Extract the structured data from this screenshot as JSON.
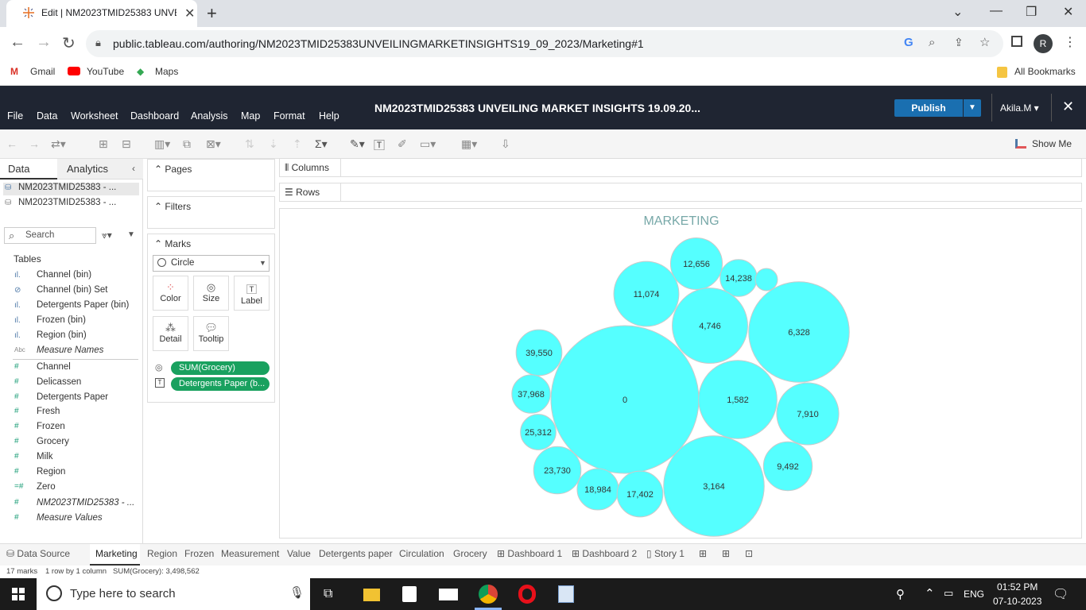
{
  "browser": {
    "tab_title": "Edit | NM2023TMID25383 UNVE",
    "url": "public.tableau.com/authoring/NM2023TMID25383UNVEILINGMARKETINSIGHTS19_09_2023/Marketing#1",
    "profile_initial": "R",
    "bookmarks": [
      "Gmail",
      "YouTube",
      "Maps"
    ],
    "all_bookmarks": "All Bookmarks"
  },
  "tableau": {
    "menus": [
      "File",
      "Data",
      "Worksheet",
      "Dashboard",
      "Analysis",
      "Map",
      "Format",
      "Help"
    ],
    "workbook_title": "NM2023TMID25383 UNVEILING MARKET INSIGHTS 19.09.20...",
    "publish_label": "Publish",
    "user": "Akila.M ▾",
    "show_me": "Show Me"
  },
  "data_pane": {
    "tab_data": "Data",
    "tab_analytics": "Analytics",
    "datasources": [
      "NM2023TMID25383 - ...",
      "NM2023TMID25383 - ..."
    ],
    "search_placeholder": "Search",
    "tables_label": "Tables",
    "dimensions": [
      "Channel (bin)",
      "Channel (bin) Set",
      "Detergents Paper (bin)",
      "Frozen (bin)",
      "Region (bin)",
      "Measure Names"
    ],
    "measures": [
      "Channel",
      "Delicassen",
      "Detergents Paper",
      "Fresh",
      "Frozen",
      "Grocery",
      "Milk",
      "Region",
      "Zero",
      "NM2023TMID25383 - ...",
      "Measure Values"
    ]
  },
  "cards": {
    "pages": "Pages",
    "filters": "Filters",
    "marks": "Marks",
    "mark_type": "Circle",
    "buttons": [
      "Color",
      "Size",
      "Label",
      "Detail",
      "Tooltip"
    ],
    "pills": [
      "SUM(Grocery)",
      "Detergents Paper (b..."
    ]
  },
  "shelves": {
    "columns": "Columns",
    "rows": "Rows"
  },
  "chart_data": {
    "type": "packed-bubble",
    "title": "MARKETING",
    "size_measure": "SUM(Grocery)",
    "label_field": "Detergents Paper (bin)",
    "color": "#55ffff",
    "labels": [
      "0",
      "12,656",
      "14,238",
      "11,074",
      "4,746",
      "6,328",
      "39,550",
      "37,968",
      "1,582",
      "7,910",
      "25,312",
      "23,730",
      "18,984",
      "17,402",
      "3,164",
      "9,492",
      ""
    ],
    "relative_size": [
      1.0,
      0.35,
      0.25,
      0.44,
      0.51,
      0.68,
      0.31,
      0.26,
      0.53,
      0.42,
      0.24,
      0.32,
      0.28,
      0.31,
      0.68,
      0.33,
      0.15
    ]
  },
  "sheet_tabs": [
    "Data Source",
    "Marketing",
    "Region",
    "Frozen",
    "Measurement",
    "Value",
    "Detergents paper",
    "Circulation",
    "Grocery",
    "Dashboard 1",
    "Dashboard 2",
    "Story 1"
  ],
  "status": {
    "marks": "17 marks",
    "rows": "1 row by 1 column",
    "sum": "SUM(Grocery): 3,498,562"
  },
  "taskbar": {
    "search": "Type here to search",
    "lang": "ENG",
    "time": "01:52 PM",
    "date": "07-10-2023"
  }
}
